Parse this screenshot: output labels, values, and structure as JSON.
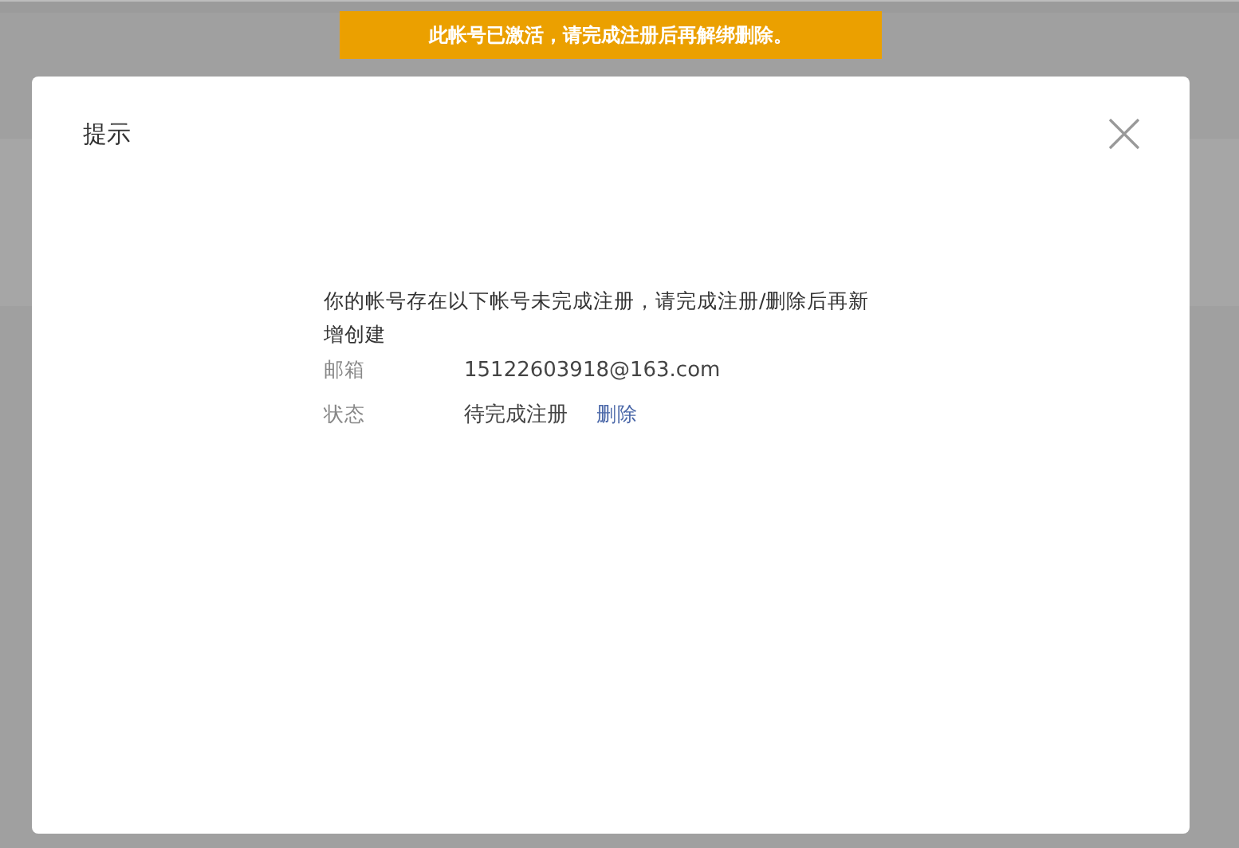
{
  "banner": {
    "text": "此帐号已激活，请完成注册后再解绑删除。"
  },
  "dialog": {
    "title": "提示",
    "message": "你的帐号存在以下帐号未完成注册，请完成注册/删除后再新增创建",
    "fields": [
      {
        "label": "邮箱",
        "value": "15122603918@163.com"
      },
      {
        "label": "状态",
        "value": "待完成注册",
        "action": "删除"
      }
    ]
  }
}
